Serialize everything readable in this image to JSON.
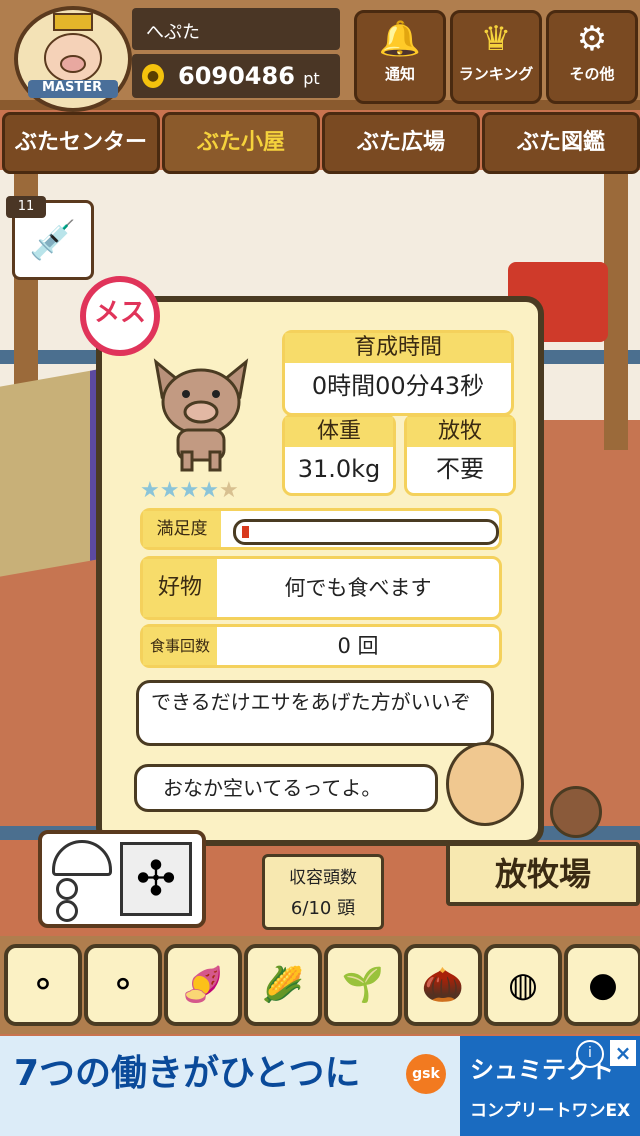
{
  "header": {
    "badge_text": "MASTER",
    "username": "へぷた",
    "points": "6090486",
    "points_unit": "pt",
    "buttons": [
      {
        "label": "通知",
        "icon": "bell-icon"
      },
      {
        "label": "ランキング",
        "icon": "crown-icon"
      },
      {
        "label": "その他",
        "icon": "gear-icon"
      }
    ]
  },
  "tabs": [
    {
      "label": "ぶたセンター"
    },
    {
      "label": "ぶた小屋"
    },
    {
      "label": "ぶた広場"
    },
    {
      "label": "ぶた図鑑"
    }
  ],
  "syringe_count": "11",
  "pig": {
    "sex_label": "メス",
    "stars_filled": 4,
    "stars_total": 5,
    "growth_time_label": "育成時間",
    "growth_time": "0時間00分43秒",
    "weight_label": "体重",
    "weight": "31.0kg",
    "graze_label": "放牧",
    "graze": "不要",
    "satisfaction_label": "満足度",
    "satisfaction_level": 0.03,
    "favorite_label": "好物",
    "favorite": "何でも食べます",
    "meals_label": "食事回数",
    "meals": "0 回"
  },
  "speech": {
    "line1": "できるだけエサをあげた方がいいぞ",
    "line2": "おなか空いてるってよ。"
  },
  "capacity": {
    "label": "収容頭数",
    "value": "6/10 頭"
  },
  "ranch_label": "放牧場",
  "foods": [
    {
      "icon": "grain-pile-icon"
    },
    {
      "icon": "seed-pile-icon"
    },
    {
      "icon": "sweet-potato-icon"
    },
    {
      "icon": "corn-icon"
    },
    {
      "icon": "beans-icon"
    },
    {
      "icon": "acorn-icon"
    },
    {
      "icon": "corn-plate-icon"
    },
    {
      "icon": "meatball-plate-icon"
    }
  ],
  "ad": {
    "headline": "7つの働きがひとつに",
    "brand_logo": "gsk",
    "brand": "シュミテクト",
    "product": "コンプリートワンEX",
    "info": "i",
    "close": "×"
  },
  "colors": {
    "accent": "#f7dc6a",
    "wood": "#7a4a22",
    "female": "#e0345a",
    "bar_fill": "#d83a1e"
  }
}
